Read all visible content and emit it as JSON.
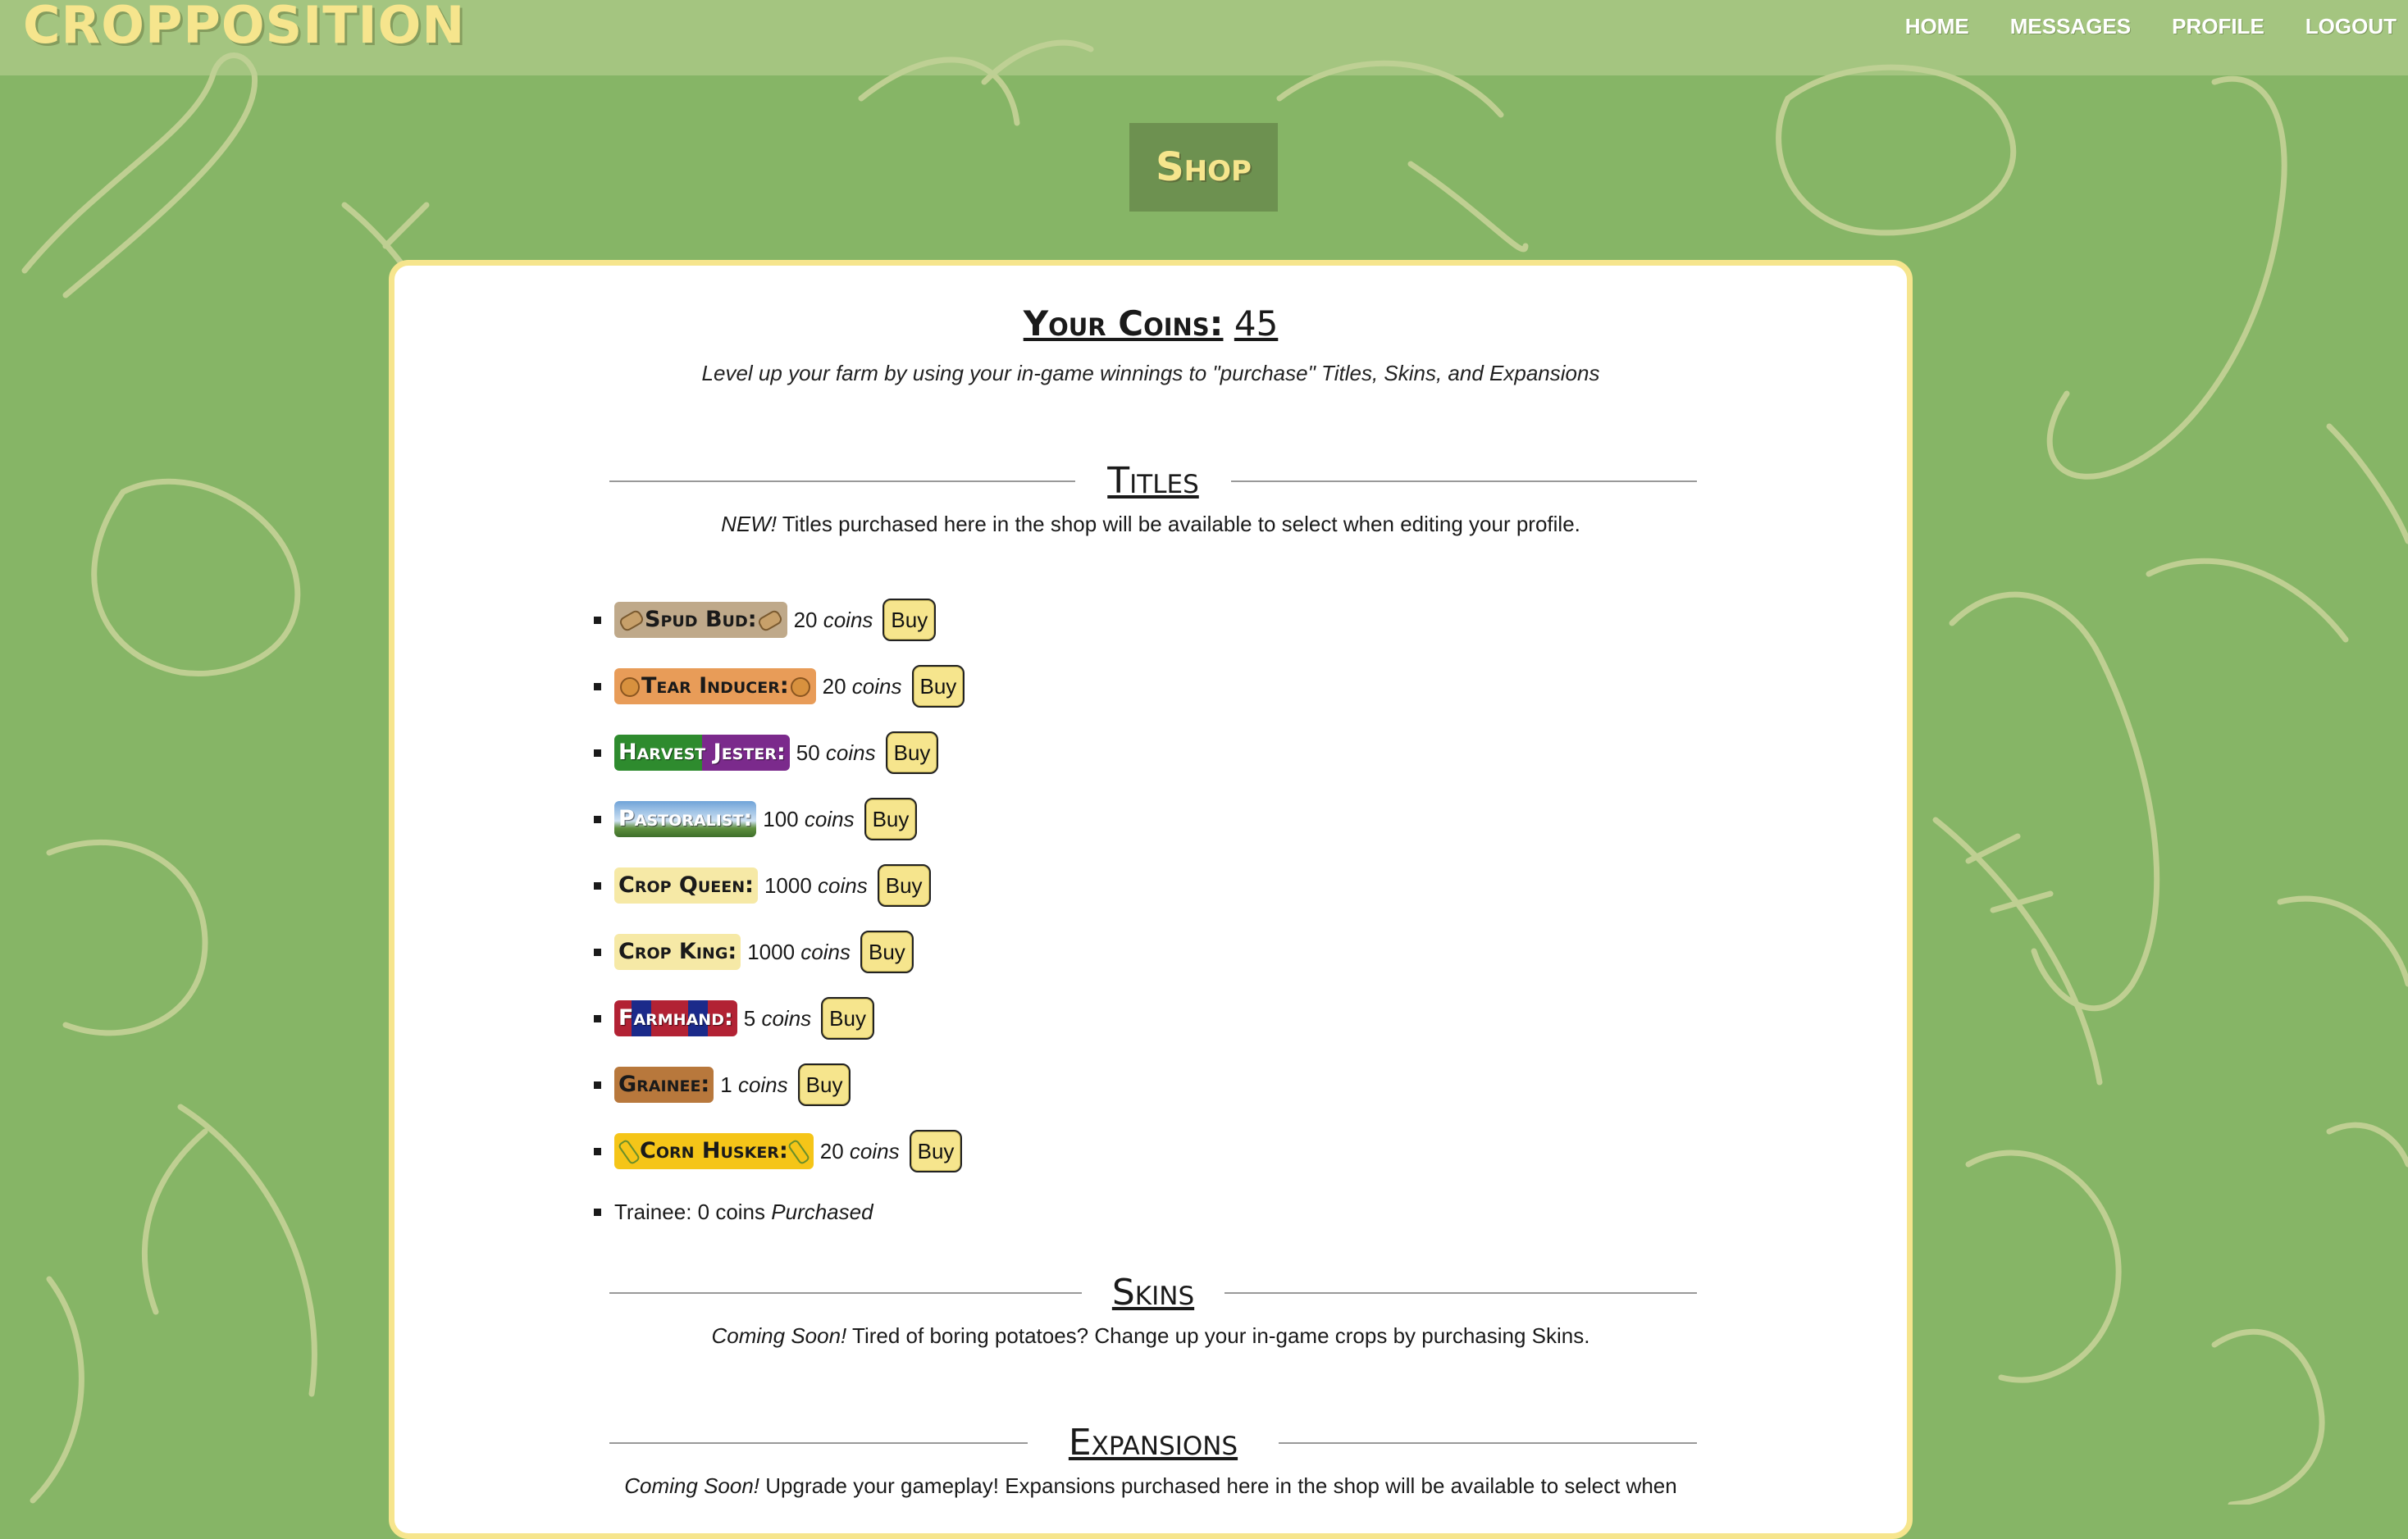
{
  "app": {
    "brand": "CROPPOSITION"
  },
  "nav": {
    "items": [
      "HOME",
      "MESSAGES",
      "PROFILE",
      "LOGOUT"
    ]
  },
  "page": {
    "title": "Shop"
  },
  "coins": {
    "label": "Your Coins:",
    "value": "45"
  },
  "tagline": "Level up your farm by using your in-game winnings to \"purchase\" Titles, Skins, and Expansions",
  "sections": {
    "titles": {
      "heading": "Titles",
      "note_em": "NEW!",
      "note_text": " Titles purchased here in the shop will be available to select when editing your profile."
    },
    "skins": {
      "heading": "Skins",
      "note_em": "Coming Soon!",
      "note_text": " Tired of boring potatoes? Change up your in-game crops by purchasing Skins."
    },
    "expansions": {
      "heading": "Expansions",
      "note_em": "Coming Soon!",
      "note_text": " Upgrade your gameplay! Expansions purchased here in the shop will be available to select when"
    }
  },
  "titles": [
    {
      "name": "Spud Bud:",
      "price": "20",
      "unit": "coins",
      "buy": "Buy",
      "icon": "potato-icon",
      "bg": "#bfa98a",
      "fg": "#1a1a1a"
    },
    {
      "name": "Tear Inducer:",
      "price": "20",
      "unit": "coins",
      "buy": "Buy",
      "icon": "onion-icon",
      "bg": "#e89c58",
      "fg": "#1a1a1a"
    },
    {
      "name": "Harvest Jester:",
      "price": "50",
      "unit": "coins",
      "buy": "Buy",
      "icon": "",
      "bg": "linear-gradient(90deg,#2e8b2e 0%,#2e8b2e 50%,#7b2a8c 50%,#7b2a8c 100%)",
      "fg": "#ffffff"
    },
    {
      "name": "Pastoralist:",
      "price": "100",
      "unit": "coins",
      "buy": "Buy",
      "icon": "",
      "bg": "linear-gradient(180deg,#6fa3d8 0%,#cfe2f3 55%,#5f8f3e 75%,#3d6e2a 100%)",
      "fg": "#ffffff"
    },
    {
      "name": "Crop Queen:",
      "price": "1000",
      "unit": "coins",
      "buy": "Buy",
      "icon": "",
      "bg": "#f6e9a6",
      "fg": "#1a1a1a"
    },
    {
      "name": "Crop King:",
      "price": "1000",
      "unit": "coins",
      "buy": "Buy",
      "icon": "",
      "bg": "#f6e9a6",
      "fg": "#1a1a1a"
    },
    {
      "name": "Farmhand:",
      "price": "5",
      "unit": "coins",
      "buy": "Buy",
      "icon": "",
      "bg": "linear-gradient(90deg,#b22234 0%,#b22234 14%,#1b2a8a 14%,#1b2a8a 30%,#b22234 30%,#b22234 50%,#b22234 60%,#1b2a8a 60%,#1b2a8a 76%,#b22234 76%,#b22234 100%)",
      "fg": "#ffffff"
    },
    {
      "name": "Grainee:",
      "price": "1",
      "unit": "coins",
      "buy": "Buy",
      "icon": "",
      "bg": "#b8783c",
      "fg": "#1a1a1a"
    },
    {
      "name": "Corn Husker:",
      "price": "20",
      "unit": "coins",
      "buy": "Buy",
      "icon": "corn-icon",
      "bg": "#f5c518",
      "fg": "#1a1a1a"
    }
  ],
  "trainee": {
    "text": "Trainee: 0 coins",
    "status": "Purchased"
  },
  "colors": {
    "background": "#86b566",
    "accent": "#f6e58d",
    "shop_title_bg": "#6d9150"
  }
}
